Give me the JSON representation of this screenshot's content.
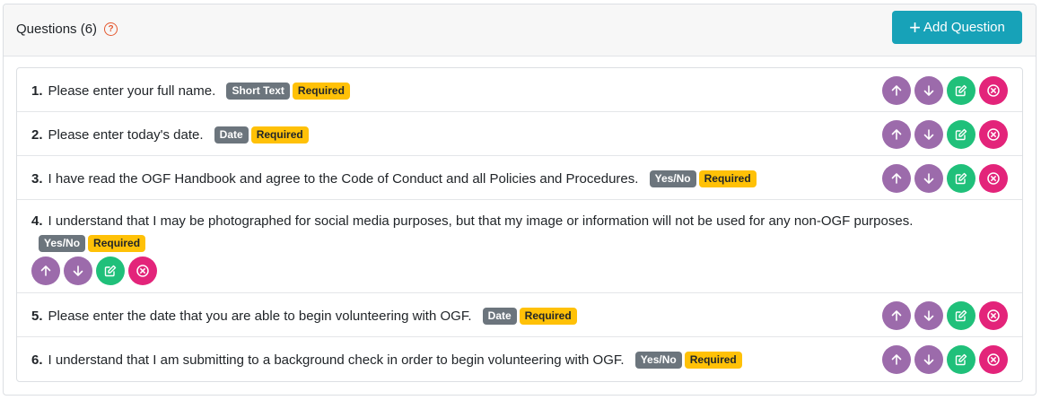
{
  "header": {
    "title": "Questions (6)",
    "help_icon": "question-circle-icon",
    "add_button_label": "Add Question",
    "add_icon": "plus-icon"
  },
  "colors": {
    "accent": "#17a2b8",
    "move": "#9c6bab",
    "edit": "#20c07a",
    "delete": "#e3247a",
    "type_badge": "#6c757d",
    "required_badge": "#ffc107",
    "help": "#e4572e"
  },
  "questions": [
    {
      "number": "1.",
      "text": "Please enter your full name.",
      "type": "Short Text",
      "required": "Required"
    },
    {
      "number": "2.",
      "text": "Please enter today's date.",
      "type": "Date",
      "required": "Required"
    },
    {
      "number": "3.",
      "text": "I have read the OGF Handbook and agree to the Code of Conduct and all Policies and Procedures.",
      "type": "Yes/No",
      "required": "Required"
    },
    {
      "number": "4.",
      "text": "I understand that I may be photographed for social media purposes, but that my image or information will not be used for any non-OGF purposes.",
      "type": "Yes/No",
      "required": "Required"
    },
    {
      "number": "5.",
      "text": "Please enter the date that you are able to begin volunteering with OGF.",
      "type": "Date",
      "required": "Required"
    },
    {
      "number": "6.",
      "text": "I understand that I am submitting to a background check in order to begin volunteering with OGF.",
      "type": "Yes/No",
      "required": "Required"
    }
  ],
  "row_actions": [
    "move-up-icon",
    "move-down-icon",
    "edit-icon",
    "delete-icon"
  ]
}
